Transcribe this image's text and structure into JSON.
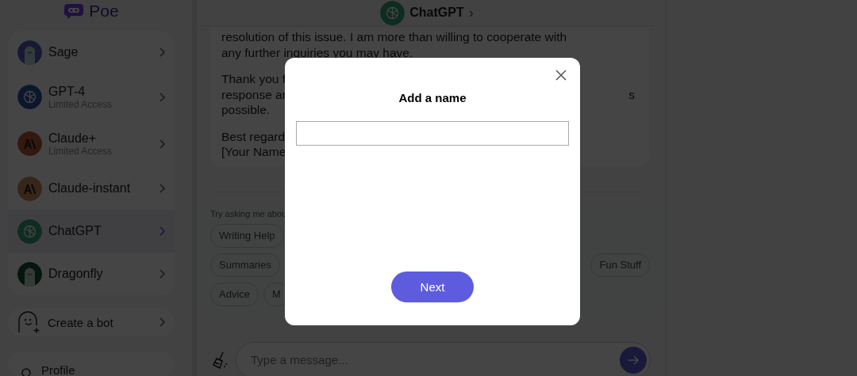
{
  "logo": {
    "text": "Poe"
  },
  "sidebar": {
    "bots": [
      {
        "name": "Sage",
        "kind": "sage",
        "selected": false
      },
      {
        "name": "GPT-4",
        "subtitle": "Limited Access",
        "kind": "gpt4",
        "selected": false
      },
      {
        "name": "Claude+",
        "subtitle": "Limited Access",
        "kind": "claude",
        "selected": false
      },
      {
        "name": "Claude-instant",
        "kind": "instant",
        "selected": false
      },
      {
        "name": "ChatGPT",
        "kind": "chatgpt",
        "selected": true
      },
      {
        "name": "Dragonfly",
        "kind": "dragonfly",
        "selected": false
      }
    ],
    "create_bot": "Create a bot",
    "profile": "Profile"
  },
  "header": {
    "title": "ChatGPT",
    "chevron": "›"
  },
  "message": {
    "paragraphs": [
      [
        {
          "left": "resolution of this issue. I am more than willing to cooperate with"
        },
        {
          "left": "any further inquiries you may have."
        }
      ],
      [
        {
          "left": "Thank you f"
        },
        {
          "left": "response ar",
          "right": "s"
        },
        {
          "left": "possible."
        }
      ],
      [
        {
          "left": "Best regard"
        },
        {
          "left": "[Your Name"
        }
      ]
    ]
  },
  "suggestions": {
    "label": "Try asking me abou",
    "rows": [
      [
        "Writing Help"
      ],
      [
        "Summaries",
        "Fun Stuff"
      ],
      [
        "Advice",
        "M"
      ]
    ]
  },
  "composer": {
    "placeholder": "Type a message..."
  },
  "modal": {
    "title": "Add a name",
    "button": "Next"
  }
}
